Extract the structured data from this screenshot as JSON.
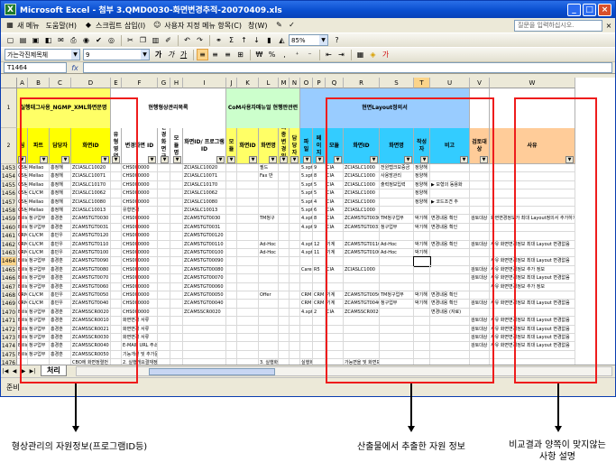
{
  "window": {
    "title": "Microsoft Excel - 첨부 3.QMD0030-화면변경추적-20070409.xls"
  },
  "menu": {
    "items": [
      "새 메뉴",
      "도움말(H)",
      "스크립트 삽입(I)",
      "사용자 지정 메뉴 항목(C)",
      "창(W)"
    ],
    "help_placeholder": "질문을 입력하십시오."
  },
  "toolbar": {
    "zoom": "85%"
  },
  "format_toolbar": {
    "font_name": "가는각진제목체",
    "font_size": "9"
  },
  "formula_bar": {
    "name_box": "T1464",
    "fx": "fx"
  },
  "columns": [
    "A",
    "B",
    "C",
    "D",
    "E",
    "F",
    "G",
    "H",
    "I",
    "J",
    "K",
    "L",
    "M",
    "N",
    "O",
    "P",
    "Q",
    "R",
    "S",
    "T",
    "U",
    "V",
    "W"
  ],
  "selected_column": "T",
  "header_bands": {
    "band1": "실행태그사용_NGMP_XML화면문명록.xls",
    "band2": "현행형상관리목록",
    "band3": "CoM사용자매뉴얼 현행판관련",
    "band4": "현면Layout정의서"
  },
  "header_fields": {
    "a": "팀",
    "b": "파트",
    "c": "담당자",
    "d": "화면ID",
    "e": "유형 영역",
    "f": "변경화면 ID",
    "g": "변경 화면 구분",
    "h": "모듈명",
    "i": "화면ID/ 프로그램ID",
    "j": "모듈",
    "k": "화면ID",
    "l": "화면명",
    "m": "최종 변경 일자",
    "n": "담당자",
    "o": "파일",
    "p": "페이지",
    "q": "모듈",
    "r": "화면ID",
    "s": "화면명",
    "t": "작성자",
    "u": "비고",
    "v": "검토대상",
    "w": "사유"
  },
  "rows": [
    {
      "num": "1453",
      "a": "CS팀",
      "b": "Mellao",
      "c": "홍정해",
      "d": "ZCIASLC10020",
      "f": "CHS000000",
      "i": "ZCIASLC10020",
      "l": "필드",
      "o": "5.xpt",
      "p": "9",
      "q": "CIA",
      "r": "ZCIASLC1000",
      "s": "전원탭크보증금",
      "t": "정양해",
      "u": "",
      "w": ""
    },
    {
      "num": "1454",
      "a": "CS팀",
      "b": "Mellao",
      "c": "홍정해",
      "d": "ZCIASLC10071",
      "f": "CHS000000",
      "i": "ZCIASLC10071",
      "l": "Fax 반",
      "o": "5.xpt",
      "p": "8",
      "q": "CIA",
      "r": "ZCIASLC1000",
      "s": "사용방관리",
      "t": "정양해",
      "u": "",
      "w": ""
    },
    {
      "num": "1455",
      "a": "CS팀",
      "b": "Mellao",
      "c": "홍정해",
      "d": "ZCIASLC10170",
      "f": "CHS000000",
      "i": "ZCIASLC10170",
      "l": "",
      "o": "5.xpt",
      "p": "5",
      "q": "CIA",
      "r": "ZCIASLC1000",
      "s": "출력정보입력",
      "t": "정양해",
      "u": "▶ 모형의 동용화",
      "w": ""
    },
    {
      "num": "1456",
      "a": "CS팀",
      "b": "CL/CM",
      "c": "홍정해",
      "d": "ZCIASLC10062",
      "f": "CHS000000",
      "i": "ZCIASLC10062",
      "l": "",
      "o": "5.xpt",
      "p": "5",
      "q": "CIA",
      "r": "ZCIASLC1000",
      "s": "",
      "t": "정양해",
      "u": "",
      "w": ""
    },
    {
      "num": "1457",
      "a": "CS팀",
      "b": "Mellao",
      "c": "홍정해",
      "d": "ZCIASLC10080",
      "f": "CHS000000",
      "i": "ZCIASLC10080",
      "l": "",
      "o": "5.xpt",
      "p": "4",
      "q": "CIA",
      "r": "ZCIASLC1000",
      "s": "",
      "t": "정양해",
      "u": "▶ 코드조견 추",
      "w": ""
    },
    {
      "num": "1458",
      "a": "CS팀",
      "b": "Mellao",
      "c": "홍정해",
      "d": "ZCIASLC10013",
      "f": "유형변경",
      "i": "ZCIASLC10013",
      "l": "",
      "o": "5.xpt",
      "p": "6",
      "q": "CIA",
      "r": "ZCIASLC1000",
      "s": "",
      "t": "",
      "u": "",
      "w": ""
    },
    {
      "num": "1459",
      "a": "Billing",
      "b": "청구업무",
      "c": "홍경훈",
      "d": "ZCAMSTGT0030",
      "f": "CHS000000",
      "i": "ZCAMSTGT0030",
      "l": "TM청구",
      "o": "4.xpt",
      "p": "8",
      "q": "CIA",
      "r": "ZCAMSTGT0030",
      "s": "TM청구업무",
      "t": "박기해",
      "u": "변경내용 확인",
      "v": "검토대상",
      "w": "화면변경정보가 최대 Layout정의서 추가하기"
    },
    {
      "num": "1460",
      "a": "Billing",
      "b": "청구업무",
      "c": "홍경훈",
      "d": "ZCAMSTGT0031",
      "f": "CHS000000",
      "i": "ZCAMSTGT0031",
      "l": "",
      "o": "4.xpt",
      "p": "9",
      "q": "CIA",
      "r": "ZCAMSTGT0031",
      "s": "청구업무",
      "t": "박기해",
      "u": "변경내용 확인",
      "v": "",
      "w": ""
    },
    {
      "num": "1461",
      "a": "CRM",
      "b": "CL/CM",
      "c": "홍민우",
      "d": "ZCAMSTGT0120",
      "f": "CHS000000",
      "i": "ZCAMSTGT00120",
      "l": "",
      "o": "",
      "p": "",
      "q": "",
      "r": "",
      "s": "",
      "t": "",
      "u": "",
      "v": "",
      "w": ""
    },
    {
      "num": "1462",
      "a": "CRM",
      "b": "CL/CM",
      "c": "홍민우",
      "d": "ZCAMSTGT0110",
      "f": "CHS000000",
      "i": "ZCAMSTGT00110",
      "l": "Ad-Hoc",
      "o": "4.xpt",
      "p": "12",
      "q": "기계",
      "r": "ZCAMSTGT0110",
      "s": "Ad-Hoc",
      "t": "박기해",
      "u": "변경내용 확인",
      "v": "검토대상",
      "w": "사유 화면변경정보 최대 Layout 변경없음"
    },
    {
      "num": "1463",
      "a": "CRM",
      "b": "CL/CM",
      "c": "홍민우",
      "d": "ZCAMSTGT0100",
      "f": "CHS000000",
      "i": "ZCAMSTGT00100",
      "l": "Ad-Hoc",
      "o": "4.xpt",
      "p": "11",
      "q": "기계",
      "r": "ZCAMSTGT0100",
      "s": "Ad-Hoc",
      "t": "박기해",
      "u": "",
      "v": "",
      "w": ""
    },
    {
      "num": "1464",
      "a": "Billing",
      "b": "청구업무",
      "c": "홍경훈",
      "d": "ZCAMSTGT0090",
      "f": "CHS000000",
      "i": "ZCAMSTGT00090",
      "l": "",
      "o": "",
      "p": "",
      "q": "",
      "r": "",
      "s": "",
      "t": "",
      "u": "",
      "v": "",
      "w": "사유 화면변경정보 최대 Layout 변경없음"
    },
    {
      "num": "1465",
      "a": "Billing",
      "b": "청구업무",
      "c": "홍경훈",
      "d": "ZCAMSTGT0080",
      "f": "CHS000000",
      "i": "ZCAMSTGT00080",
      "l": "",
      "o": "Care",
      "p": "R5",
      "q": "CIA",
      "r": "ZCIASLC1000",
      "s": "",
      "t": "",
      "u": "",
      "v": "검토대상",
      "w": "사유 화면변경정보 추가 정보"
    },
    {
      "num": "1466",
      "a": "Billing",
      "b": "청구업무",
      "c": "홍경훈",
      "d": "ZCAMSTGT0070",
      "f": "CHS000000",
      "i": "ZCAMSTGT00070",
      "l": "",
      "o": "",
      "p": "",
      "q": "",
      "r": "",
      "s": "",
      "t": "",
      "u": "",
      "v": "검토대상",
      "w": "사유 화면변경정보 최대 Layout 변경없음"
    },
    {
      "num": "1467",
      "a": "Billing",
      "b": "청구업무",
      "c": "홍경훈",
      "d": "ZCAMSTGT0060",
      "f": "CHS000000",
      "i": "ZCAMSTGT00060",
      "l": "",
      "o": "",
      "p": "",
      "q": "",
      "r": "",
      "s": "",
      "t": "",
      "u": "",
      "v": "",
      "w": "사유 화면변경정보 추가 정보"
    },
    {
      "num": "1468",
      "a": "CRM",
      "b": "CL/CM",
      "c": "홍민우",
      "d": "ZCAMSTGT0050",
      "f": "CHS000000",
      "i": "ZCAMSTGT00050",
      "l": "Offer",
      "o": "CRM",
      "p": "CRM",
      "q": "기계",
      "r": "ZCAMSTGT0050",
      "s": "TM청구업무",
      "t": "박기해",
      "u": "변경내용 확인",
      "v": "",
      "w": ""
    },
    {
      "num": "1469",
      "a": "CRM",
      "b": "CL/CM",
      "c": "홍민우",
      "d": "ZCAMSTGT0040",
      "f": "CHS000000",
      "i": "ZCAMSTGT00040",
      "l": "",
      "o": "CRM",
      "p": "CRM",
      "q": "기계",
      "r": "ZCAMSTGT0040",
      "s": "청구업무",
      "t": "박기해",
      "u": "변경내용 확인",
      "v": "검토대상",
      "w": "사유 화면변경정보 최대 Layout 변경없음"
    },
    {
      "num": "1470",
      "a": "Billing",
      "b": "청구업무",
      "c": "홍경훈",
      "d": "ZCAMSSCR0020",
      "f": "CHS000000",
      "i": "ZCAMSSCR0020",
      "l": "",
      "o": "4.xpt",
      "p": "2",
      "q": "CIA",
      "r": "ZCAMSSCR0020",
      "s": "",
      "t": "",
      "u": "변경내용 (자료)",
      "v": "",
      "w": ""
    },
    {
      "num": "1471",
      "a": "Billing",
      "b": "청구업무",
      "c": "홍경훈",
      "d": "ZCAMSSCR0010",
      "f": "화면변경 서류",
      "i": "",
      "l": "",
      "o": "",
      "p": "",
      "q": "",
      "r": "",
      "s": "",
      "t": "",
      "u": "",
      "v": "검토대상",
      "w": "사유 화면변경정보 최대 Layout 변경없음"
    },
    {
      "num": "1472",
      "a": "Billing",
      "b": "청구업무",
      "c": "홍경훈",
      "d": "ZCAMSSCR0021",
      "f": "화면변경 서류",
      "i": "",
      "l": "",
      "o": "",
      "p": "",
      "q": "",
      "r": "",
      "s": "",
      "t": "",
      "u": "",
      "v": "검토대상",
      "w": "사유 화면변경정보 최대 Layout 변경없음"
    },
    {
      "num": "1473",
      "a": "Billing",
      "b": "청구업무",
      "c": "홍경훈",
      "d": "ZCAMSSCR0030",
      "f": "화면변경 서류",
      "i": "",
      "l": "",
      "o": "",
      "p": "",
      "q": "",
      "r": "",
      "s": "",
      "t": "",
      "u": "",
      "v": "검토대상",
      "w": "사유 화면변경정보 최대 Layout 변경없음"
    },
    {
      "num": "1474",
      "a": "Billing",
      "b": "청구업무",
      "c": "홍경훈",
      "d": "ZCAMSSCR0040",
      "f": "E-MAIL URL 주소",
      "i": "",
      "l": "",
      "o": "",
      "p": "",
      "q": "",
      "r": "",
      "s": "",
      "t": "",
      "u": "",
      "v": "검토대상",
      "w": "사유 화면변경정보 최대 Layout 변경없음"
    },
    {
      "num": "1475",
      "a": "Billing",
      "b": "청구업무",
      "c": "홍경훈",
      "d": "ZCAMSSCR0050",
      "f": "기능개선 및 추가문구사용 방법",
      "i": "",
      "l": "",
      "o": "",
      "p": "",
      "q": "",
      "r": "",
      "s": "",
      "t": "",
      "u": "",
      "v": "",
      "w": ""
    },
    {
      "num": "1476",
      "a": "",
      "b": "",
      "c": "",
      "d": "CBO에 화면정렬번 23번 화면",
      "f": "2. 실행개요결재정보 기록지 정정변경 DISPLAY",
      "i": "",
      "l": "3. 실행화면",
      "o": "실행화 변경서 화면표지",
      "p": "",
      "q": "",
      "r": "가능면을 및 화면표지",
      "s": "",
      "t": "",
      "u": "",
      "v": "",
      "w": ""
    }
  ],
  "sheet_tabs": [
    "처리"
  ],
  "status": "준비",
  "annotations": {
    "left": "형상관리의 자원정보(프로그램ID등)",
    "middle": "산출물에서 추출한 자원 정보",
    "right_line1": "비교결과 양쪽이 맞지않는",
    "right_line2": "사항 설명"
  }
}
